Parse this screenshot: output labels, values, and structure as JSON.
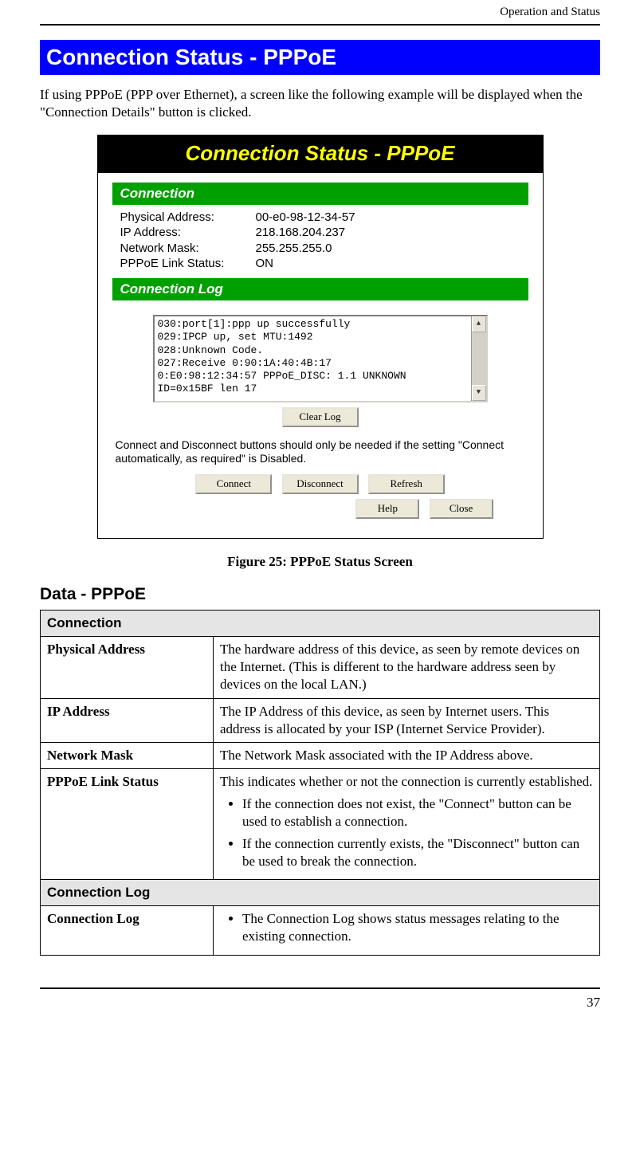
{
  "header": {
    "right": "Operation and Status"
  },
  "section_title": "Connection Status - PPPoE",
  "intro": "If using PPPoE (PPP over Ethernet), a screen like the following example will be displayed when the \"Connection Details\" button is clicked.",
  "screenshot": {
    "banner": "Connection Status - PPPoE",
    "section_connection": "Connection",
    "fields": {
      "physical_address_label": "Physical Address:",
      "physical_address": "00-e0-98-12-34-57",
      "ip_address_label": "IP Address:",
      "ip_address": "218.168.204.237",
      "network_mask_label": "Network Mask:",
      "network_mask": "255.255.255.0",
      "pppoe_link_label": "PPPoE Link Status:",
      "pppoe_link": "ON"
    },
    "section_log": "Connection Log",
    "log_lines": "030:port[1]:ppp up successfully\n029:IPCP up, set MTU:1492\n028:Unknown Code.\n027:Receive 0:90:1A:40:4B:17\n0:E0:98:12:34:57 PPPoE_DISC: 1.1 UNKNOWN\nID=0x15BF len 17",
    "buttons": {
      "clear_log": "Clear Log",
      "connect": "Connect",
      "disconnect": "Disconnect",
      "refresh": "Refresh",
      "help": "Help",
      "close": "Close"
    },
    "note": "Connect and Disconnect buttons should only be needed if the setting \"Connect automatically, as required\" is Disabled."
  },
  "caption": "Figure 25: PPPoE Status Screen",
  "subhead": "Data - PPPoE",
  "table": {
    "section1": "Connection",
    "rows1": {
      "physical_address": {
        "term": "Physical Address",
        "desc": "The hardware address of this device, as seen by remote devices on the Internet. (This is different to the hardware address seen by devices on the local LAN.)"
      },
      "ip_address": {
        "term": "IP Address",
        "desc": "The IP Address of this device, as seen by Internet users. This address is allocated by your ISP (Internet Service Provider)."
      },
      "network_mask": {
        "term": "Network Mask",
        "desc": "The Network Mask associated with the IP Address above."
      },
      "pppoe_link": {
        "term": "PPPoE Link Status",
        "desc_intro": "This indicates whether or not the connection is currently established.",
        "bullet1": "If the connection does not exist, the \"Connect\" button can be used to establish a connection.",
        "bullet2": "If the connection currently exists, the \"Disconnect\" button can be used to break the connection."
      }
    },
    "section2": "Connection Log",
    "rows2": {
      "connection_log": {
        "term": "Connection Log",
        "bullet": "The Connection Log shows status messages relating to the existing connection."
      }
    }
  },
  "page_number": "37"
}
